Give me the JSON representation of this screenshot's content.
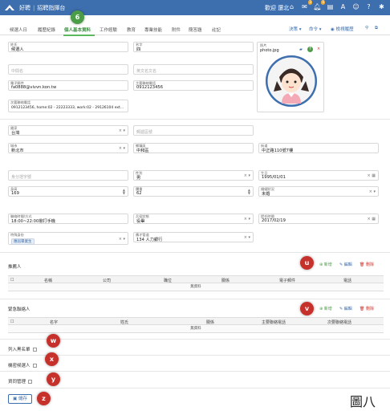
{
  "app": {
    "brand": "好聘",
    "sep": "|",
    "console": "招聘指揮台",
    "welcome": "歡迎 還北",
    "badges": {
      "mail": "3",
      "bell": "0"
    },
    "icons": [
      "home-icon",
      "mail-icon",
      "bell-icon",
      "doc-icon",
      "font-icon",
      "user-icon",
      "question-icon",
      "settings-icon"
    ]
  },
  "tabs": [
    {
      "label": "候選人日"
    },
    {
      "label": "履歷紀錄"
    },
    {
      "label": "個人基本資料"
    },
    {
      "label": "工作經驗"
    },
    {
      "label": "教育"
    },
    {
      "label": "專業技能"
    },
    {
      "label": "附件"
    },
    {
      "label": "簡答題"
    },
    {
      "label": "註記"
    }
  ],
  "tab_tools": {
    "decision": "決策 ▾",
    "command": "命令 ▾",
    "history": "檢視履歷"
  },
  "markers": {
    "tab": "6",
    "u": "u",
    "v": "v",
    "w": "w",
    "x": "x",
    "y": "y",
    "z": "z"
  },
  "form": {
    "surname": {
      "label": "姓氏",
      "value": "候選人"
    },
    "given": {
      "label": "名字",
      "value": "四"
    },
    "middle": {
      "placeholder": "中間名"
    },
    "english": {
      "placeholder": "英文名文名"
    },
    "email": {
      "label": "電子郵件",
      "value": "fa0888@vivvn.kon.tw"
    },
    "phone": {
      "label": "主要聯絡電話",
      "value": "0912123456"
    },
    "other_phone": {
      "label": "次要聯絡電話",
      "value": "0912123456, home:02 - 22223333, work:02 - 29126104 ext..."
    },
    "photo": {
      "label": "照片",
      "file": "photo.jpg"
    },
    "country": {
      "label": "國家",
      "value": "台灣"
    },
    "postal": {
      "placeholder": "郵遞區號"
    },
    "city": {
      "label": "城市",
      "value": "新北市"
    },
    "district": {
      "label": "鄉鎮區",
      "value": "中和區"
    },
    "street": {
      "label": "街道",
      "value": "中正路110號7樓"
    },
    "idnum": {
      "placeholder": "身分證字號"
    },
    "gender": {
      "label": "性別",
      "value": "男"
    },
    "birthday": {
      "label": "生日",
      "value": "1995/01/01"
    },
    "height": {
      "label": "身高",
      "value": "169"
    },
    "weight": {
      "label": "體重",
      "value": "62"
    },
    "marital": {
      "label": "婚姻狀況",
      "value": "未婚"
    },
    "contact_time": {
      "label": "聯絡時間/方式",
      "value": "18:00~22:00撥打手機"
    },
    "military": {
      "label": "兵役狀態",
      "value": "役畢"
    },
    "available": {
      "label": "提任時間",
      "value": "2017/02/19"
    },
    "special": {
      "label": "特殊身份",
      "chip": "應屆畢業生"
    },
    "source": {
      "label": "應才管道",
      "value": "134 人力銀行"
    }
  },
  "referee": {
    "title": "推薦人",
    "add": "新增",
    "edit": "編輯",
    "del": "刪除",
    "columns": [
      "名稱",
      "公司",
      "職位",
      "關係",
      "電子郵件",
      "電話"
    ],
    "empty": "無資料"
  },
  "emergency": {
    "title": "緊急聯絡人",
    "add": "新增",
    "edit": "編輯",
    "del": "刪除",
    "columns": [
      "名字",
      "姓氏",
      "關係",
      "主要聯絡電話",
      "次要聯絡電話"
    ],
    "empty": "無資料"
  },
  "checks": [
    {
      "label": "列入黑名單"
    },
    {
      "label": "機密候選人"
    },
    {
      "label": "資同管理"
    }
  ],
  "save": "儲存",
  "figure": "圖八",
  "colors": {
    "brand": "#3d6fae",
    "marker": "#c7312b",
    "tab_marker": "#4c9d48"
  }
}
